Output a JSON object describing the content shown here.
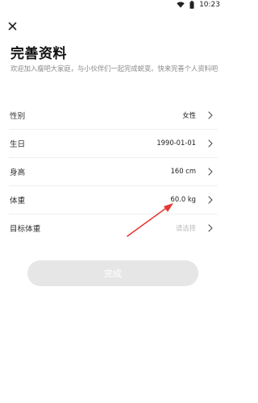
{
  "status_bar": {
    "time": "10:23"
  },
  "page": {
    "title": "完善资料",
    "subtitle": "欢迎加入瘦吧大家庭，与小伙伴们一起完成蜕变。快来完善个人资料吧"
  },
  "form": {
    "rows": [
      {
        "label": "性别",
        "value": "女性"
      },
      {
        "label": "生日",
        "value": "1990-01-01"
      },
      {
        "label": "身高",
        "value": "160 cm"
      },
      {
        "label": "体重",
        "value": "60.0 kg"
      },
      {
        "label": "目标体重",
        "placeholder": "请选择"
      }
    ]
  },
  "submit": {
    "label": "完成"
  },
  "colors": {
    "annotation_arrow": "#e53935",
    "button_disabled": "#e6e6e6"
  },
  "icons": [
    "wifi-icon",
    "battery-icon",
    "close-icon",
    "chevron-right-icon"
  ]
}
